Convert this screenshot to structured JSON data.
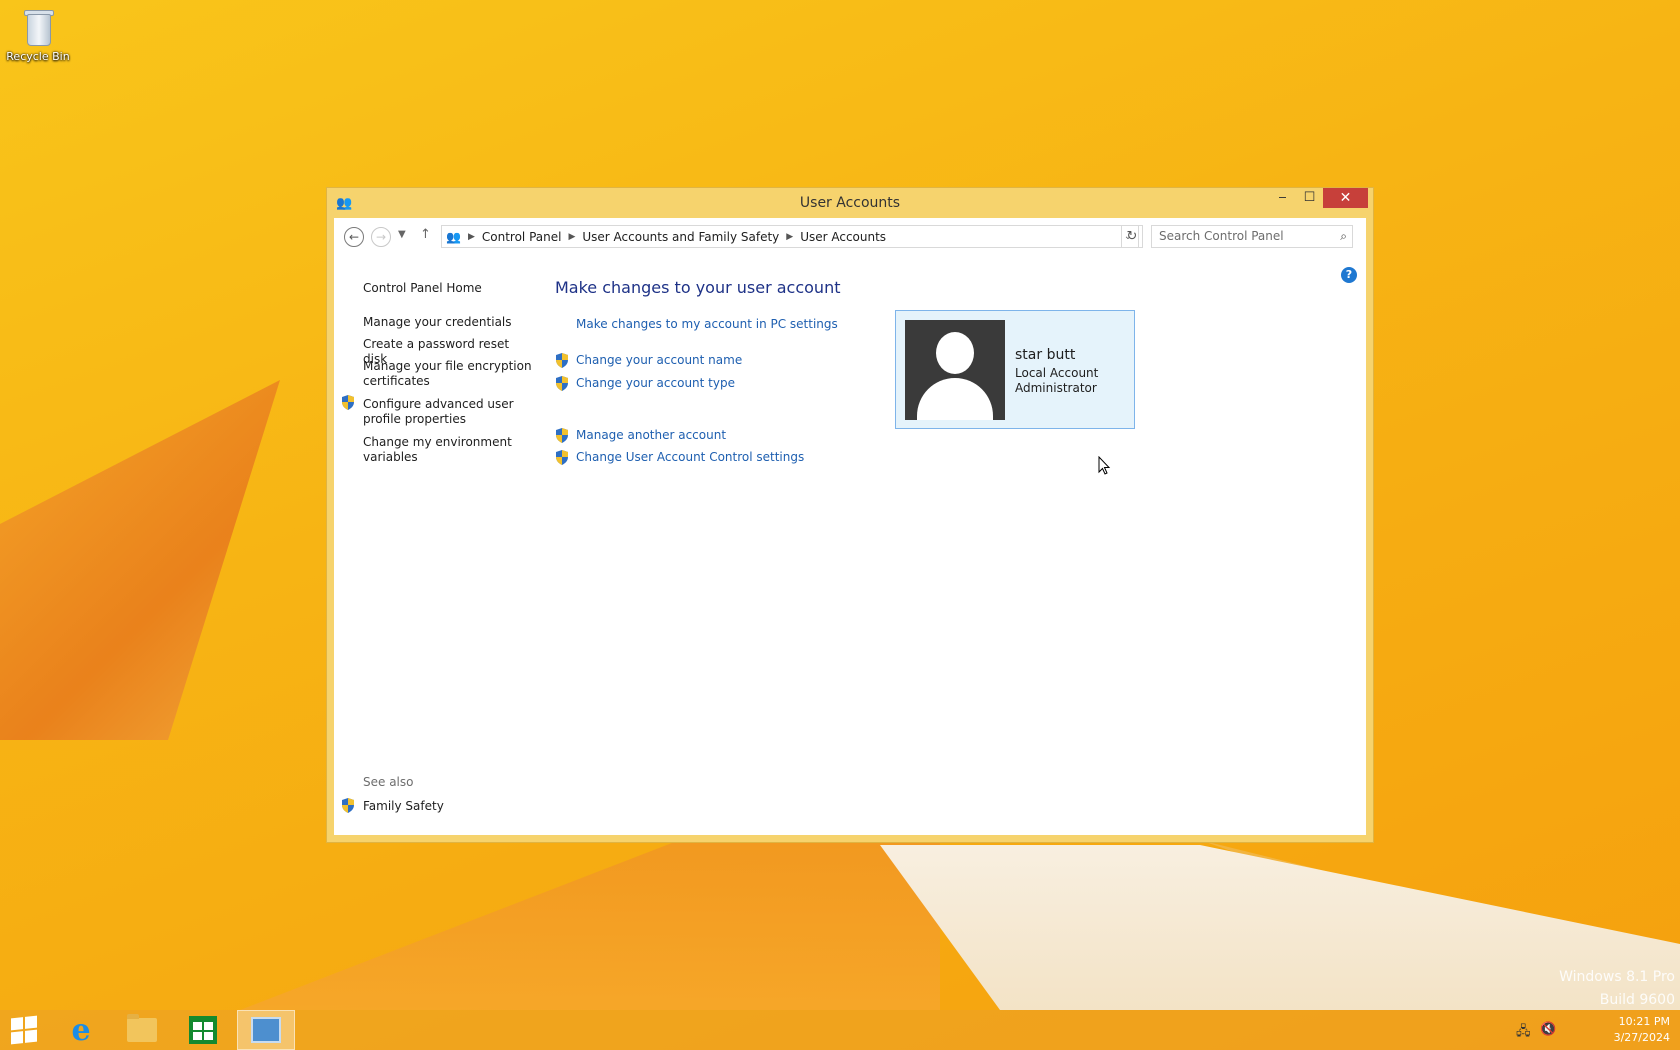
{
  "desktop": {
    "recycle_bin_label": "Recycle Bin",
    "watermark": {
      "line1": "Windows 8.1 Pro",
      "line2": "Build 9600"
    }
  },
  "window": {
    "title": "User Accounts",
    "controls": {
      "minimize": "‒",
      "maximize": "☐",
      "close": "✕"
    }
  },
  "navbar": {
    "breadcrumbs": [
      "Control Panel",
      "User Accounts and Family Safety",
      "User Accounts"
    ],
    "search_placeholder": "Search Control Panel",
    "help_label": "?"
  },
  "left_pane": {
    "home": "Control Panel Home",
    "items": [
      {
        "label": "Manage your credentials",
        "shield": false
      },
      {
        "label": "Create a password reset disk",
        "shield": false
      },
      {
        "label": "Manage your file encryption certificates",
        "shield": false
      },
      {
        "label": "Configure advanced user profile properties",
        "shield": true
      },
      {
        "label": "Change my environment variables",
        "shield": false
      }
    ],
    "see_also_label": "See also",
    "see_also_items": [
      {
        "label": "Family Safety",
        "shield": true
      }
    ]
  },
  "main": {
    "title": "Make changes to your user account",
    "pc_settings_link": "Make changes to my account in PC settings",
    "tasks": [
      {
        "label": "Change your account name",
        "shield": true
      },
      {
        "label": "Change your account type",
        "shield": true
      }
    ],
    "other_tasks": [
      {
        "label": "Manage another account",
        "shield": true
      },
      {
        "label": "Change User Account Control settings",
        "shield": true
      }
    ]
  },
  "user": {
    "name": "star butt",
    "account_kind": "Local Account",
    "role": "Administrator"
  },
  "taskbar": {
    "apps": [
      "start",
      "internet-explorer",
      "file-explorer",
      "store",
      "control-panel"
    ],
    "active_app": "control-panel",
    "clock": {
      "time": "10:21 PM",
      "date": "3/27/2024"
    }
  },
  "colors": {
    "link": "#1e5fb0",
    "heading": "#1e3287",
    "window_frame": "#f6d36d",
    "close_button": "#c7403a",
    "selected_tile": "#e5f3fb"
  }
}
